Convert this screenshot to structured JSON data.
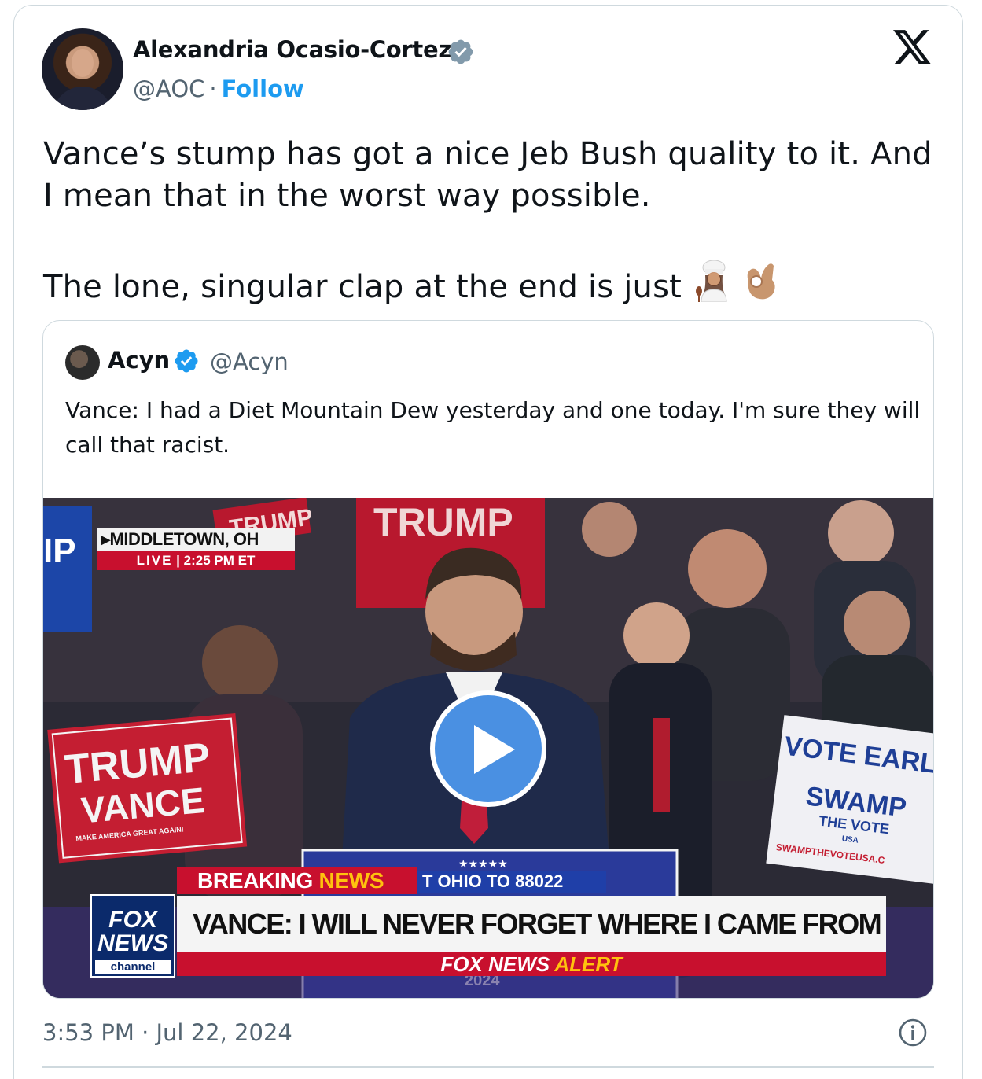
{
  "author": {
    "name": "Alexandria Ocasio-Cortez",
    "handle": "@AOC",
    "separator": "·",
    "follow_label": "Follow"
  },
  "tweet": {
    "line1": "Vance’s stump has got a nice Jeb Bush quality to it. And I mean that in the worst way possible.",
    "line2": "The lone, singular clap at the end is just",
    "emojis": [
      "woman-cook-emoji",
      "ok-hand-emoji"
    ]
  },
  "quote": {
    "name": "Acyn",
    "handle": "@Acyn",
    "text": "Vance: I had a Diet Mountain Dew yesterday and one today. I'm sure they will call that racist."
  },
  "video": {
    "location": "MIDDLETOWN, OH",
    "live_label": "LIVE",
    "live_time": "2:25 PM ET",
    "breaking": "BREAKING",
    "news": "NEWS",
    "ticker_text": "T OHIO TO 88022",
    "headline": "VANCE: I WILL NEVER FORGET WHERE I CAME FROM",
    "alert_prefix": "FOX NEWS",
    "alert_word": "ALERT",
    "logo_line1": "FOX",
    "logo_line2": "NEWS",
    "logo_line3": "channel",
    "sign_trump": "TRUMP",
    "sign_vance": "VANCE",
    "sign_maga": "MAKE AMERICA GREAT AGAIN!",
    "sign_vote_early": "VOTE EARL",
    "sign_swamp": "SWAMP",
    "sign_the_vote": "THE VOTE",
    "sign_usa": "USA",
    "sign_url": "SWAMPTHEVOTEUSA.C",
    "podium_stars": "★★★★★",
    "podium_year": "2024"
  },
  "footer": {
    "timestamp": "3:53 PM · Jul 22, 2024"
  },
  "colors": {
    "link": "#1d9bf0",
    "secondary_text": "#536471",
    "border": "#cfd9de",
    "fox_red": "#c8102e",
    "fox_blue": "#0b2a6b",
    "play": "#4a90e2"
  }
}
